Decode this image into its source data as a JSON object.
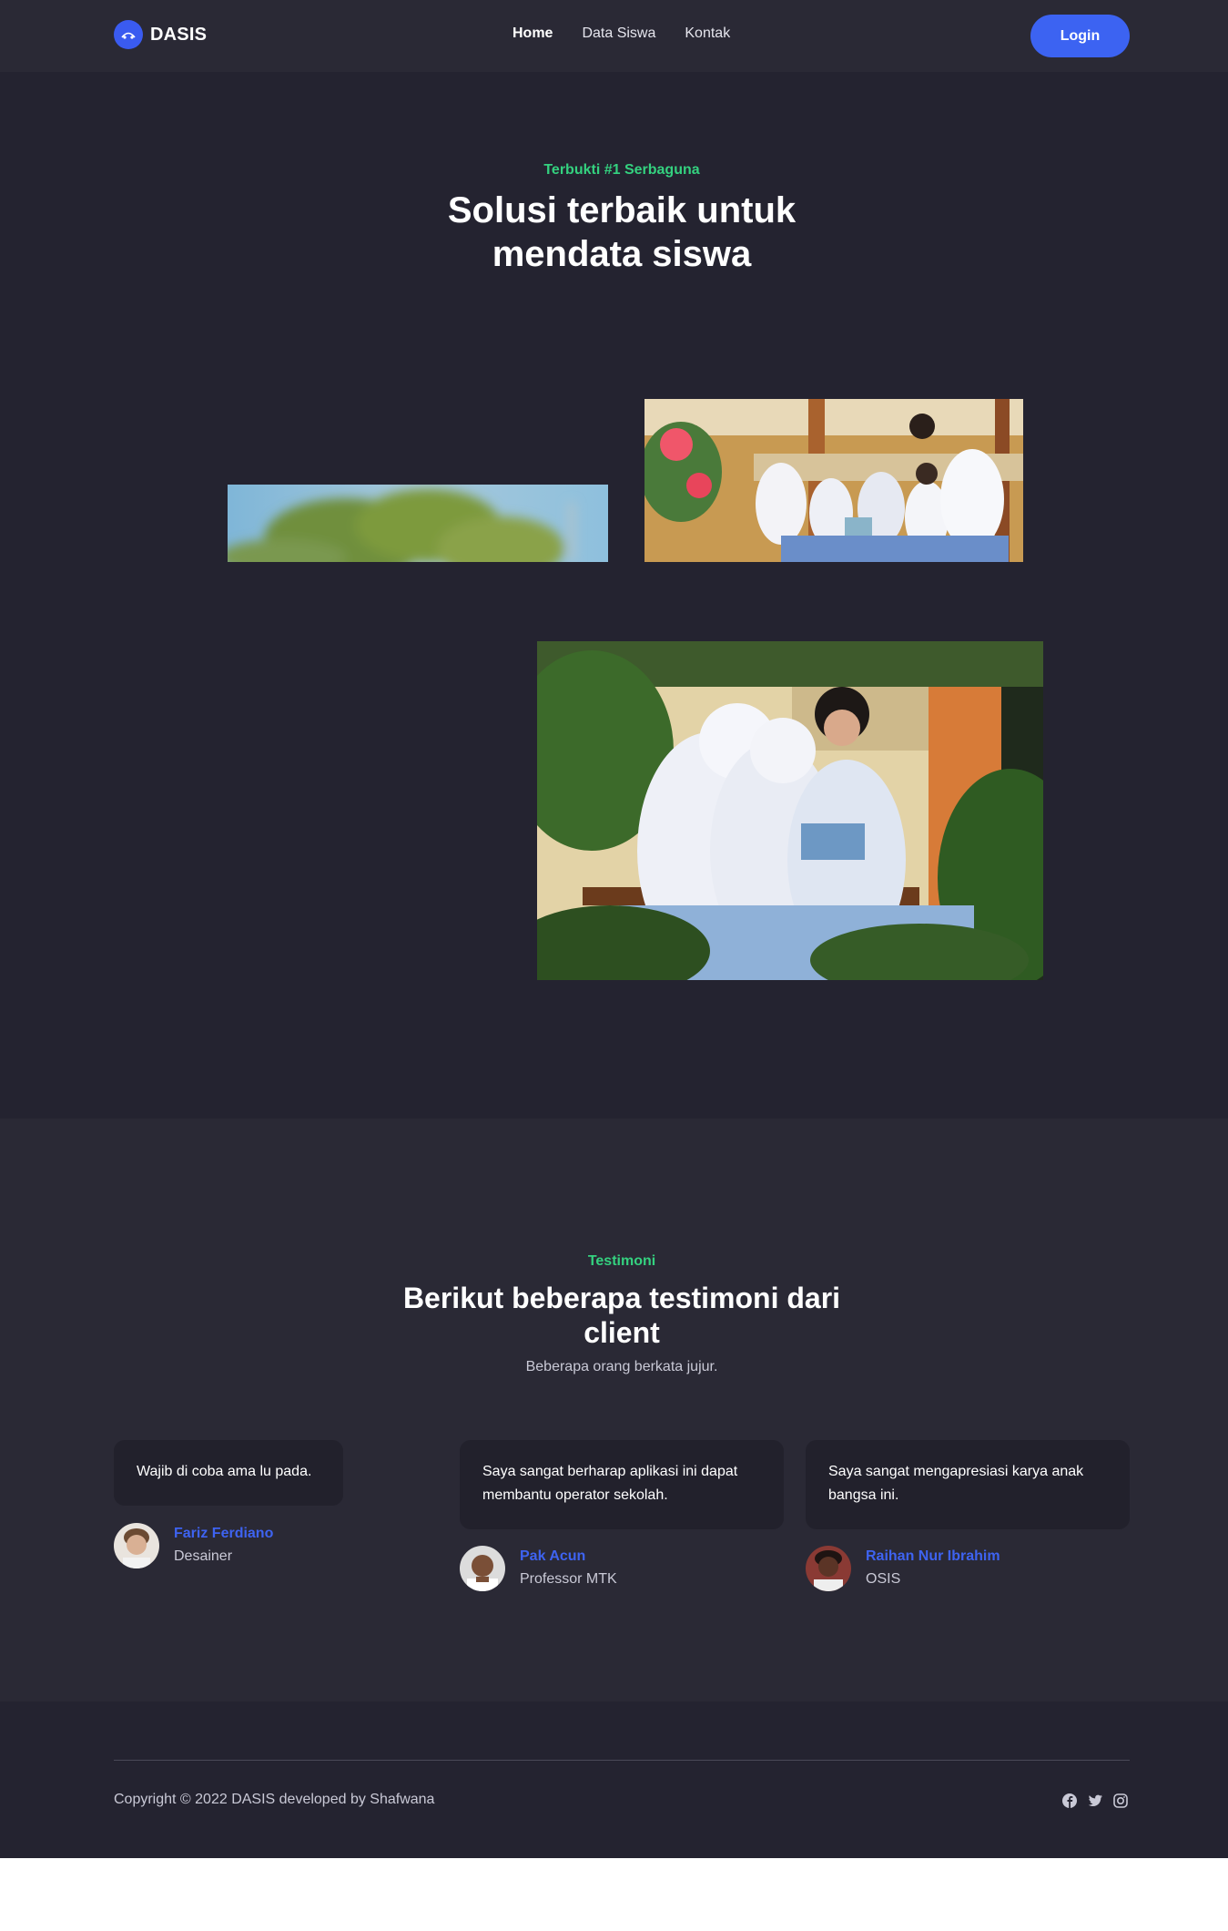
{
  "header": {
    "brand": "DASIS",
    "nav": [
      {
        "label": "Home",
        "active": true
      },
      {
        "label": "Data Siswa",
        "active": false
      },
      {
        "label": "Kontak",
        "active": false
      }
    ],
    "login_label": "Login"
  },
  "hero": {
    "kicker": "Terbukti #1 Serbaguna",
    "title_line1": "Solusi terbaik untuk",
    "title_line2": "mendata siswa"
  },
  "testimonials": {
    "kicker": "Testimoni",
    "title_line1": "Berikut beberapa testimoni dari",
    "title_line2": "client",
    "subtitle": "Beberapa orang berkata jujur.",
    "items": [
      {
        "quote": "Wajib di coba ama lu pada.",
        "name": "Fariz Ferdiano",
        "role": "Desainer"
      },
      {
        "quote": "Saya sangat berharap aplikasi ini dapat membantu operator sekolah.",
        "name": "Pak Acun",
        "role": "Professor MTK"
      },
      {
        "quote": "Saya sangat mengapresiasi karya anak bangsa ini.",
        "name": "Raihan Nur Ibrahim",
        "role": "OSIS"
      }
    ]
  },
  "footer": {
    "copyright": "Copyright © 2022 DASIS developed by Shafwana",
    "social_icons": [
      "facebook-icon",
      "twitter-icon",
      "instagram-icon"
    ]
  },
  "colors": {
    "accent": "#3c63f2",
    "kicker_green": "#34d17f",
    "header_bg": "#2a2935",
    "hero_bg": "#242330"
  }
}
